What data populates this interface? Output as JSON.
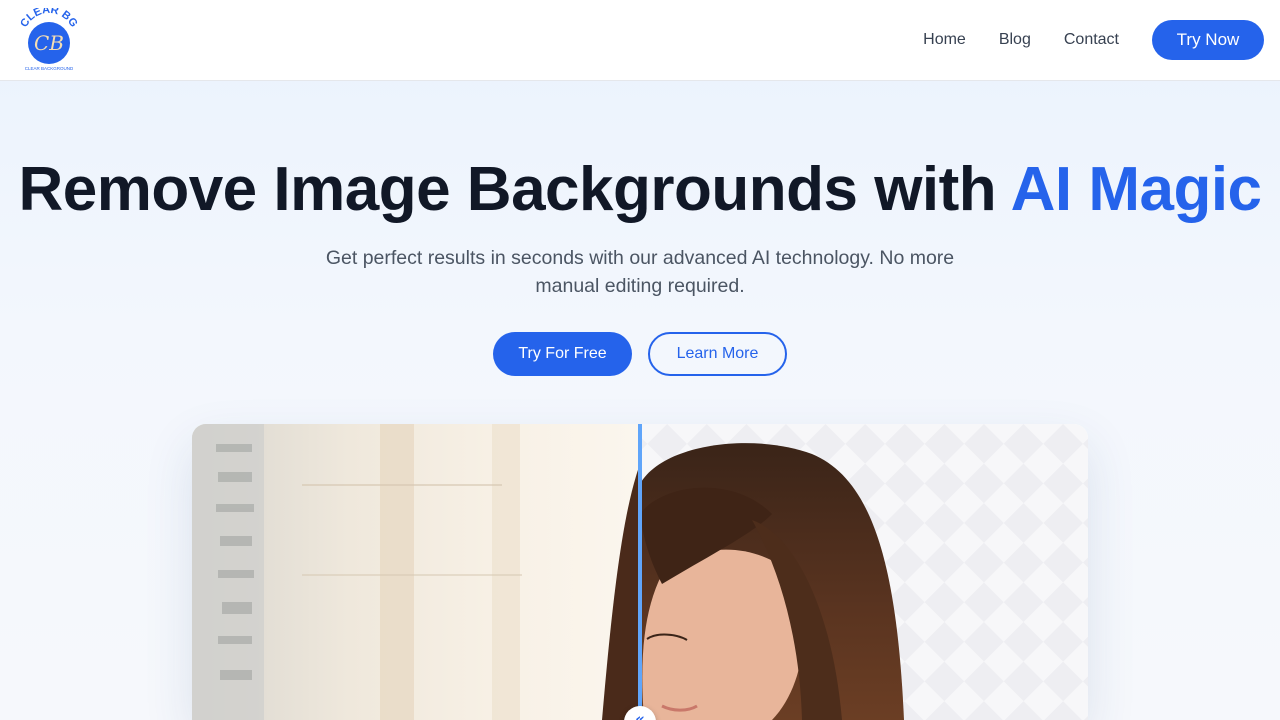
{
  "brand": {
    "logo_top_text": "CLEAR BG",
    "logo_monogram": "CB",
    "logo_bottom_text": "CLEAR BACKGROUND"
  },
  "nav": {
    "items": [
      {
        "label": "Home"
      },
      {
        "label": "Blog"
      },
      {
        "label": "Contact"
      }
    ],
    "cta_label": "Try Now"
  },
  "hero": {
    "title_main": "Remove Image Backgrounds with ",
    "title_accent": "AI Magic",
    "subtitle": "Get perfect results in seconds with our advanced AI technology. No more manual editing required.",
    "primary_button": "Try For Free",
    "secondary_button": "Learn More"
  },
  "comparison": {
    "slider_position": 0.5,
    "handle_glyph": "«"
  },
  "colors": {
    "accent": "#2563eb",
    "divider": "#60a5fa",
    "heading": "#111827",
    "body_text": "#4b5563"
  }
}
